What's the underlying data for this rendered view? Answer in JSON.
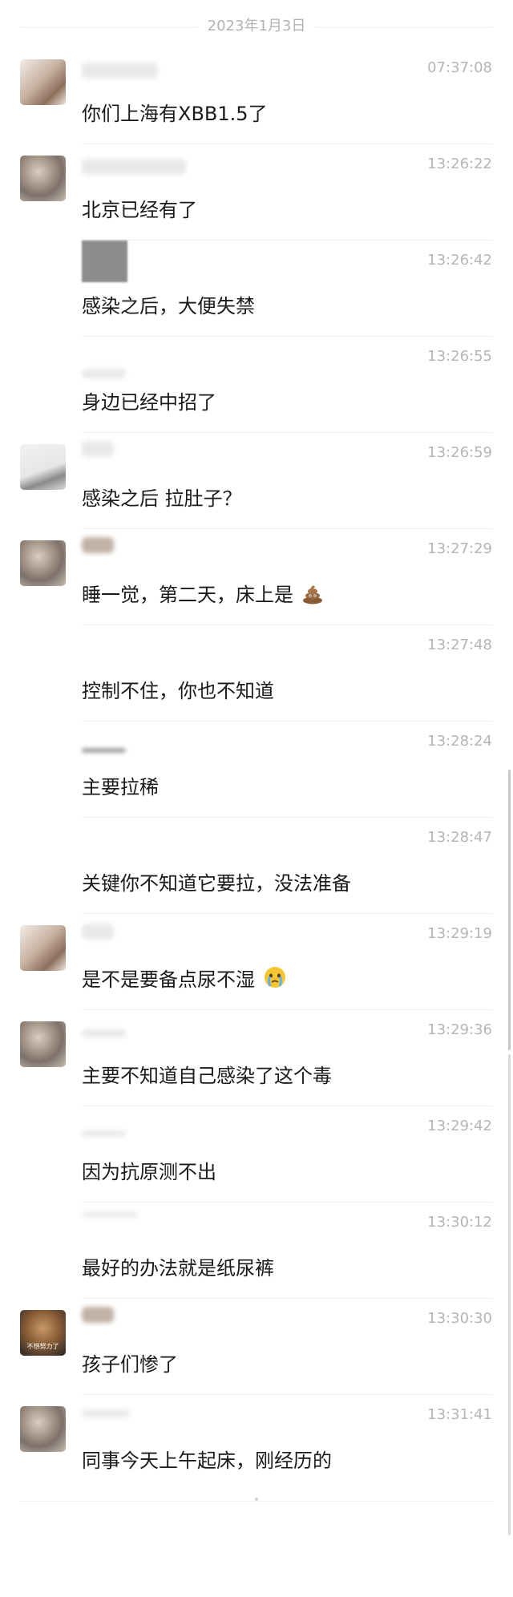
{
  "date_header": "2023年1月3日",
  "messages": [
    {
      "time": "07:37:08",
      "text": "你们上海有XBB1.5了"
    },
    {
      "time": "13:26:22",
      "text": "北京已经有了"
    },
    {
      "time": "13:26:42",
      "text": "感染之后，大便失禁"
    },
    {
      "time": "13:26:55",
      "text": "身边已经中招了"
    },
    {
      "time": "13:26:59",
      "text": "感染之后 拉肚子？"
    },
    {
      "time": "13:27:29",
      "text": "睡一觉，第二天，床上是"
    },
    {
      "time": "13:27:48",
      "text": "控制不住，你也不知道"
    },
    {
      "time": "13:28:24",
      "text": "主要拉稀"
    },
    {
      "time": "13:28:47",
      "text": "关键你不知道它要拉，没法准备"
    },
    {
      "time": "13:29:19",
      "text": "是不是要备点尿不湿"
    },
    {
      "time": "13:29:36",
      "text": "主要不知道自己感染了这个毒"
    },
    {
      "time": "13:29:42",
      "text": "因为抗原测不出"
    },
    {
      "time": "13:30:12",
      "text": "最好的办法就是纸尿裤"
    },
    {
      "time": "13:30:30",
      "text": "孩子们惨了"
    },
    {
      "time": "13:31:41",
      "text": "同事今天上午起床，刚经历的"
    }
  ],
  "avatar_caption": "不想努力了",
  "icons": {
    "poop": "poop-emoji",
    "crying": "crying-face-emoji"
  },
  "colors": {
    "time": "#b5b5b5",
    "text": "#1a1a1a",
    "divider": "#efefef"
  }
}
